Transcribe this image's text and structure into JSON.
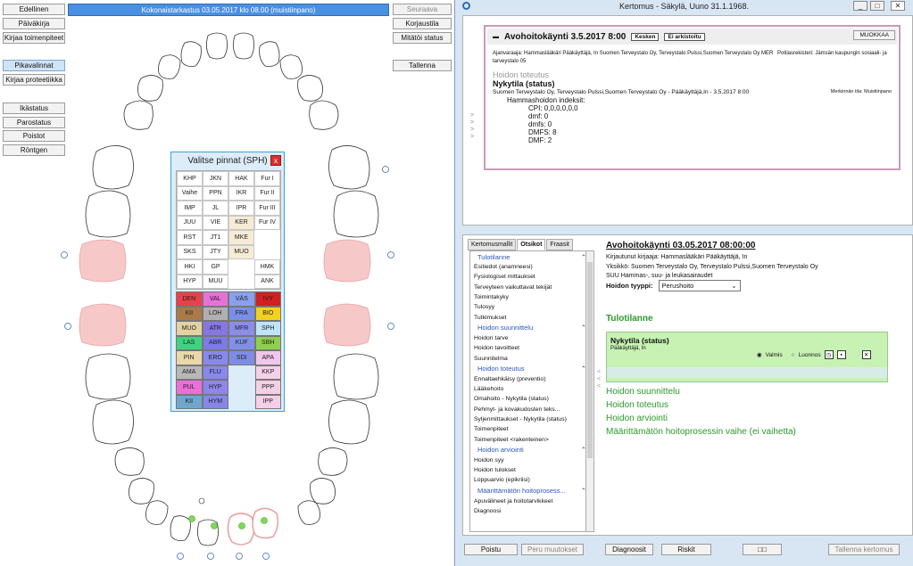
{
  "left": {
    "nav_buttons": [
      "Edellinen",
      "Päiväkirja",
      "Kirjaa toimenpiteet"
    ],
    "mid_buttons": [
      "Pikavalinnat",
      "Kirjaa proteetiikka"
    ],
    "low_buttons": [
      "Ikästatus",
      "Parostatus",
      "Poistot",
      "Röntgen"
    ],
    "banner": "Kokonaistarkastus 03.05.2017  klo 08.00  (muistiinpano)",
    "right_buttons": [
      "Seuraava",
      "Korjaustila",
      "Mitätöi status"
    ],
    "save": "Tallenna"
  },
  "dialog": {
    "title": "Valitse pinnat (SPH)",
    "close": "x",
    "top_grid": [
      [
        "KHP",
        "JKN",
        "HAK",
        "Fur I"
      ],
      [
        "Vaihe",
        "PPN",
        "IKR",
        "Fur II"
      ],
      [
        "IMP",
        "JL",
        "IPR",
        "Fur III"
      ],
      [
        "JUU",
        "VIE",
        "KER",
        "Fur IV"
      ],
      [
        "RST",
        "JT1",
        "MKE",
        ""
      ],
      [
        "SKS",
        "JTY",
        "MUO",
        ""
      ],
      [
        "HKI",
        "GP",
        "",
        "HMK"
      ],
      [
        "HYP",
        "MUU",
        "",
        "ANK"
      ]
    ],
    "color_grid": [
      [
        [
          "DEN",
          "#e8414b"
        ],
        [
          "VAL",
          "#e870d8"
        ],
        [
          "VÄS",
          "#8aa0ee"
        ],
        [
          "IVY",
          "#d21f1f"
        ]
      ],
      [
        [
          "KII",
          "#a97a48"
        ],
        [
          "LOH",
          "#b0b0b0"
        ],
        [
          "FRA",
          "#7b8ee6"
        ],
        [
          "BIO",
          "#f2d21d"
        ]
      ],
      [
        [
          "MUO",
          "#e3d3a3"
        ],
        [
          "ATR",
          "#8678e0"
        ],
        [
          "MFR",
          "#8a8ee6"
        ],
        [
          "SPH",
          "#bfe3f7"
        ]
      ],
      [
        [
          "LAS",
          "#3fd37f"
        ],
        [
          "ABR",
          "#7c7ce6"
        ],
        [
          "KUF",
          "#8090ea"
        ],
        [
          "SBH",
          "#8fcf4f"
        ]
      ],
      [
        [
          "PIN",
          "#e9d8a8"
        ],
        [
          "ERO",
          "#8888ee"
        ],
        [
          "SDI",
          "#7e8de4"
        ],
        [
          "APA",
          "#f2c6ec"
        ]
      ],
      [
        [
          "AMA",
          "#b8b8b8"
        ],
        [
          "FLU",
          "#8888ee"
        ],
        [
          "",
          ""
        ],
        [
          "KKP",
          "#f6d0e8"
        ]
      ],
      [
        [
          "PUL",
          "#ec6fd8"
        ],
        [
          "HYP",
          "#8e86ea"
        ],
        [
          "",
          ""
        ],
        [
          "PPP",
          "#f4d0e6"
        ]
      ],
      [
        [
          "KII",
          "#6fa7cc"
        ],
        [
          "HYM",
          "#8686ea"
        ],
        [
          "",
          ""
        ],
        [
          "IPP",
          "#f4d0e6"
        ]
      ]
    ]
  },
  "window": {
    "title": "Kertomus - Säkylä, Uuno 31.1.1968.",
    "visit_title": "Avohoitokäynti 3.5.2017 8:00",
    "tag1": "Kesken",
    "tag2": "Ei arkistoitu",
    "edit": "MUOKKAA",
    "booker": "Ajanvaraaja: Hammaslääkäri Pääkäyttäjä, In Suomen Terveystalo Oy, Terveystalo Pulssi,Suomen Terveystalo Oy MER",
    "booker2": "tarveystalo 05",
    "register": "Potilasrekisteri: Jämsän kaupungin sosiaali- ja",
    "hoidon": "Hoidon toteutus",
    "nykytila": "Nykytila (status)",
    "org": "Suomen Terveystalo Oy, Terveystalo Pulssi,Suomen Terveystalo Oy - Pääkäyttäjä,In - 3.5.2017 8:00",
    "merkinta": "Merkinnän tila: Muistiinpano",
    "indexes_title": "Hammashoidon indeksit:",
    "indexes": [
      "CPI: 0,0,0,0,0,0",
      "dmf: 0",
      "dmfs: 0",
      "DMFS: 8",
      "DMF: 2"
    ],
    "tabs": [
      "Kertomusmallit",
      "Otsikot",
      "Fraasit"
    ],
    "tree": [
      {
        "h": "Tulotilanne"
      },
      {
        "i": "Esitiedot (anamneesi)"
      },
      {
        "i": "Fysiologiset mittaukset"
      },
      {
        "i": "Terveyteen vaikuttavat tekijät"
      },
      {
        "i": "Toimintakyky"
      },
      {
        "i": "Tulosyy"
      },
      {
        "i": "Tutkimukset"
      },
      {
        "h": "Hoidon suunnittelu"
      },
      {
        "i": "Hoidon tarve"
      },
      {
        "i": "Hoidon tavoitteet"
      },
      {
        "i": "Suunnitelma"
      },
      {
        "h": "Hoidon toteutus"
      },
      {
        "i": "Ennaltaehkäisy (preventio)"
      },
      {
        "i": "Lääkehoito"
      },
      {
        "i": "Omahoito - Nykytila (status)"
      },
      {
        "i": "Pehmyt- ja kovakudosten teks..."
      },
      {
        "i": "Syljenmittaukset - Nykytila (status)"
      },
      {
        "i": "Toimenpiteet"
      },
      {
        "i": "Toimenpiteet <rakenteinen>"
      },
      {
        "h": "Hoidon arviointi"
      },
      {
        "i": "Hoidon syy"
      },
      {
        "i": "Hoidon tulokset"
      },
      {
        "i": "Loppuarvio (epikriisi)"
      },
      {
        "h": "Määrittämätön hoitoprosess..."
      },
      {
        "i": "Apuvälineet ja hoitotarvikkeet"
      },
      {
        "i": "Diagnoosi"
      }
    ],
    "c_title": "Avohoitokäynti 03.05.2017 08:00:00",
    "c_author": "Kirjautunut kirjaaja: Hammaslääkäri Pääkäyttäjä, In",
    "c_unit": "Yksikkö: Suomen Terveystalo Oy, Terveystalo Pulssi,Suomen Terveystalo Oy",
    "c_dept": "SUU Hammas-, suu- ja leukasairaudet",
    "c_type_label": "Hoidon tyyppi:",
    "c_type": "Perushoito",
    "c_tulo": "Tulotilanne",
    "c_status": "Nykytila (status)",
    "c_status_user": "Pääkäyttäjä, In",
    "c_valmis": "Valmis",
    "c_luonnos": "Luonnos",
    "c_sections": [
      "Hoidon suunnittelu",
      "Hoidon toteutus",
      "Hoidon arviointi",
      "Määrittämätön hoitoprosessin vaihe (ei vaihetta)"
    ],
    "footer": [
      "Poistu",
      "Peru muutokset",
      "Diagnoosit",
      "Riskit",
      "□□",
      "Tallenna kertomus"
    ]
  }
}
